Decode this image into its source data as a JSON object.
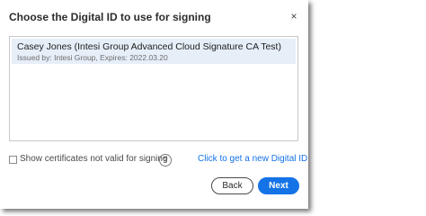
{
  "dialog": {
    "title": "Choose the Digital ID to use for signing",
    "close_glyph": "×"
  },
  "digital_ids": [
    {
      "name": "Casey Jones (Intesi Group Advanced Cloud Signature CA Test)",
      "issuer_line": "Issued by: Intesi Group, Expires: 2022.03.20"
    }
  ],
  "options": {
    "show_invalid_label": "Show certificates not valid for signing",
    "show_invalid_checked": false,
    "help_glyph": "?",
    "new_id_link": "Click to get a new Digital ID"
  },
  "buttons": {
    "back": "Back",
    "next": "Next"
  },
  "colors": {
    "accent": "#1473e6",
    "selection": "#e6eef8"
  }
}
